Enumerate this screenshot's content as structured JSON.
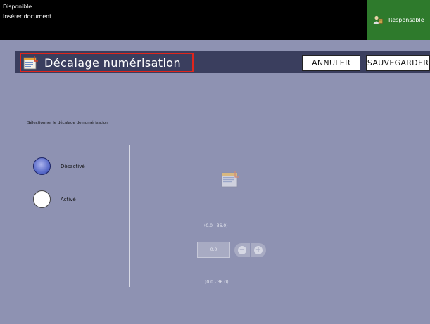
{
  "status": {
    "line1": "Disponible...",
    "line2": "Insérer document",
    "role_button": {
      "label": "Responsable",
      "icon": "user-role-icon"
    }
  },
  "header": {
    "title": "Décalage numérisation",
    "icon": "scan-document-icon",
    "cancel_label": "ANNULER",
    "save_label": "SAUVEGARDER"
  },
  "main": {
    "instruction": "Sélectionner le décalage de numérisation",
    "options": [
      {
        "label": "Désactivé",
        "selected": true
      },
      {
        "label": "Activé",
        "selected": false
      }
    ],
    "range_top": "(0.0 - 36.0)",
    "value": "0.0",
    "range_bottom": "(0.0 - 36.0)",
    "stepper": {
      "minus": "−",
      "plus": "+"
    }
  },
  "colors": {
    "background": "#8e92b2",
    "status_bar": "#000000",
    "role_button": "#2e7a2c",
    "header_bar": "#3a3e5e",
    "highlight": "#e0251c",
    "radio_selected": "#5466c6"
  }
}
